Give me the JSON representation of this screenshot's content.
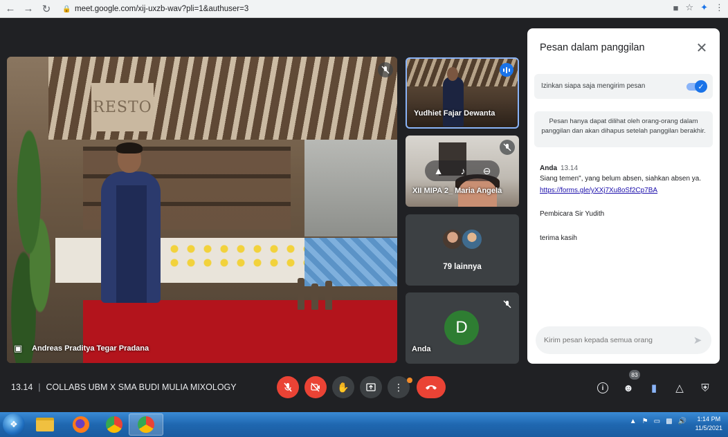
{
  "browser": {
    "url": "meet.google.com/xij-uxzb-wav?pli=1&authuser=3"
  },
  "main_video": {
    "participant_name": "Andreas Praditya Tegar Pradana",
    "sign_text": "RESTO"
  },
  "tiles": {
    "yudhiet": {
      "name": "Yudhiet Fajar Dewanta"
    },
    "maria": {
      "name": "XII MIPA 2_ Maria Angela"
    },
    "others": {
      "label": "79 lainnya"
    },
    "anda": {
      "name": "Anda",
      "avatar_letter": "D"
    }
  },
  "chat": {
    "title": "Pesan dalam panggilan",
    "allow_label": "Izinkan siapa saja mengirim pesan",
    "allow_enabled": true,
    "notice": "Pesan hanya dapat dilihat oleh orang-orang dalam panggilan dan akan dihapus setelah panggilan berakhir.",
    "sender": "Anda",
    "time": "13.14",
    "messages": [
      "Siang temen\", yang belum absen, siahkan absen ya.",
      "https://forms.gle/yXXj7Xu8oSf2Cp7BA",
      "Pembicara Sir Yudith",
      "terima kasih"
    ],
    "input_placeholder": "Kirim pesan kepada semua orang"
  },
  "meeting": {
    "time": "13.14",
    "title": "COLLABS UBM X SMA BUDI MULIA MIXOLOGY",
    "participant_count": "83"
  },
  "taskbar": {
    "clock_time": "1:14 PM",
    "clock_date": "11/5/2021"
  },
  "colors": {
    "background": "#202124",
    "accent_blue": "#1a73e8",
    "end_call_red": "#ea4335",
    "avatar_green": "#2e7d32"
  }
}
